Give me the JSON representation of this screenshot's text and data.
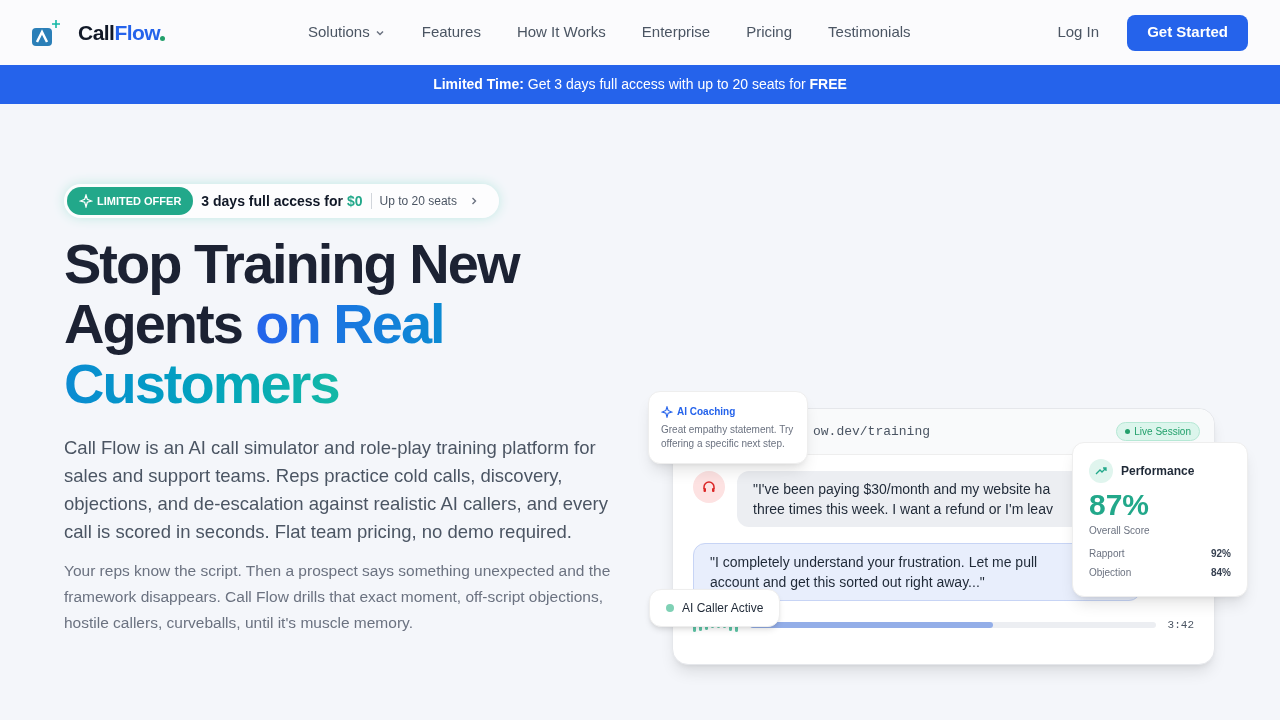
{
  "brand": {
    "name_part_1": "Call",
    "name_part_2": "Flow"
  },
  "nav": [
    {
      "label": "Solutions",
      "dropdown": true
    },
    {
      "label": "Features",
      "dropdown": false
    },
    {
      "label": "How It Works",
      "dropdown": false
    },
    {
      "label": "Enterprise",
      "dropdown": false
    },
    {
      "label": "Pricing",
      "dropdown": false
    },
    {
      "label": "Testimonials",
      "dropdown": false
    }
  ],
  "login": "Log In",
  "cta": "Get Started",
  "banner": "**Limited Time:** Get 3 days full access with up to 20 seats for **FREE**",
  "offer": {
    "badge": "LIMITED OFFER",
    "text": "3 days full access for",
    "price": "$0",
    "seats": "Up to 20 seats"
  },
  "headline": [
    {
      "text": "Stop Training New Agents",
      "kind": "plain"
    },
    {
      "text": "on Real Customers",
      "kind": "gradient"
    }
  ],
  "lead": "Call Flow is an AI call simulator and role-play training platform for sales and support teams. Reps practice cold calls, discovery, objections, and de-escalation against realistic AI callers, and every call is scored in seconds. Flat team pricing, no demo required.",
  "body": "Your reps know the script. Then a prospect says something unexpected and the framework disappears. Call Flow drills that exact moment, off-script objections, hostile callers, curveballs, until it's muscle memory.",
  "mockup": {
    "url": "ow.dev/training",
    "live": "Live Session",
    "messages": [
      {
        "kind": "caller",
        "lines": [
          "\"I've been paying $30/month and my website ha",
          "three times this week. I want a refund or I'm leav"
        ]
      },
      {
        "kind": "agent",
        "lines": [
          "\"I completely understand your frustration. Let me pull",
          "account and get this sorted out right away...\""
        ]
      }
    ],
    "progress": {
      "level": 0.6
    },
    "time": "3:42"
  },
  "coaching": {
    "title": "AI Coaching",
    "text": "Great empathy statement. Try offering a specific next step."
  },
  "performance": {
    "title": "Performance",
    "score": "87%",
    "score_label": "Overall Score",
    "metrics": [
      {
        "name": "Rapport",
        "value": "92%"
      },
      {
        "name": "Objection",
        "value": "84%"
      }
    ]
  },
  "caller_status": {
    "label": "AI Caller Active",
    "active": true
  }
}
